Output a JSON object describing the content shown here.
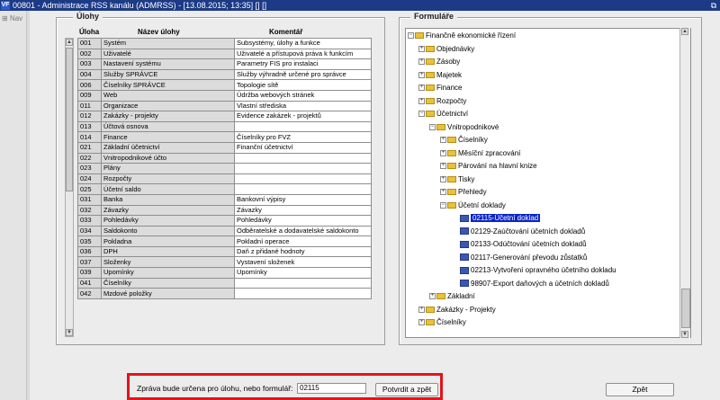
{
  "window": {
    "title": "00801 - Administrace RSS kanálu (ADMRSS) - [13.08.2015; 13:35] [] []",
    "app_icon": "VF",
    "restore_icon": "restore-window-icon"
  },
  "sidenav": {
    "label": "Nav"
  },
  "tasks_panel": {
    "title": "Úlohy",
    "headers": {
      "uloha": "Úloha",
      "nazev": "Název úlohy",
      "komentar": "Komentář"
    },
    "rows": [
      [
        "001",
        "Systém",
        "Subsystémy, úlohy a funkce"
      ],
      [
        "002",
        "Uživatelé",
        "Uživatelé a přístupová práva k funkcím"
      ],
      [
        "003",
        "Nastavení systému",
        "Parametry FIS pro instalaci"
      ],
      [
        "004",
        "Služby SPRÁVCE",
        "Služby výhradně určené pro správce"
      ],
      [
        "006",
        "Číselníky SPRÁVCE",
        "Topologie sítě"
      ],
      [
        "009",
        "Web",
        "Údržba webových stránek"
      ],
      [
        "011",
        "Organizace",
        "Vlastní střediska"
      ],
      [
        "012",
        "Zakázky - projekty",
        "Evidence zakázek - projektů"
      ],
      [
        "013",
        "Účtová osnova",
        ""
      ],
      [
        "014",
        "Finance",
        "Číselníky pro FVZ"
      ],
      [
        "021",
        "Základní účetnictví",
        "Finanční účetnictví"
      ],
      [
        "022",
        "Vnitropodnikové účto",
        ""
      ],
      [
        "023",
        "Plány",
        ""
      ],
      [
        "024",
        "Rozpočty",
        ""
      ],
      [
        "025",
        "Účetní saldo",
        ""
      ],
      [
        "031",
        "Banka",
        "Bankovní výpisy"
      ],
      [
        "032",
        "Závazky",
        "Závazky"
      ],
      [
        "033",
        "Pohledávky",
        "Pohledávky"
      ],
      [
        "034",
        "Saldokonto",
        "Odběratelské a dodavatelské saldokonto"
      ],
      [
        "035",
        "Pokladna",
        "Pokladní operace"
      ],
      [
        "036",
        "DPH",
        "Daň z přidané hodnoty"
      ],
      [
        "037",
        "Složenky",
        "Vystavení složenek"
      ],
      [
        "039",
        "Upomínky",
        "Upomínky"
      ],
      [
        "041",
        "Číselníky",
        ""
      ],
      [
        "042",
        "Mzdové položky",
        ""
      ]
    ]
  },
  "forms_panel": {
    "title": "Formuláře",
    "tree": [
      {
        "level": 0,
        "label": "Finančně ekonomické řízení",
        "icon": "folder-open-icon",
        "expander": "−"
      },
      {
        "level": 1,
        "label": "Objednávky",
        "icon": "folder-icon",
        "expander": "+"
      },
      {
        "level": 1,
        "label": "Zásoby",
        "icon": "folder-icon",
        "expander": "+"
      },
      {
        "level": 1,
        "label": "Majetek",
        "icon": "folder-icon",
        "expander": "+"
      },
      {
        "level": 1,
        "label": "Finance",
        "icon": "folder-icon",
        "expander": "+"
      },
      {
        "level": 1,
        "label": "Rozpočty",
        "icon": "folder-icon",
        "expander": "+"
      },
      {
        "level": 1,
        "label": "Účetnictví",
        "icon": "folder-open-icon",
        "expander": "−"
      },
      {
        "level": 2,
        "label": "Vnitropodnikové",
        "icon": "folder-open-icon",
        "expander": "−"
      },
      {
        "level": 3,
        "label": "Číselníky",
        "icon": "folder-icon",
        "expander": "+"
      },
      {
        "level": 3,
        "label": "Měsíční zpracování",
        "icon": "folder-icon",
        "expander": "+"
      },
      {
        "level": 3,
        "label": "Párování na hlavní knize",
        "icon": "folder-icon",
        "expander": "+"
      },
      {
        "level": 3,
        "label": "Tisky",
        "icon": "folder-icon",
        "expander": "+"
      },
      {
        "level": 3,
        "label": "Přehledy",
        "icon": "folder-icon",
        "expander": "+"
      },
      {
        "level": 3,
        "label": "Účetní doklady",
        "icon": "folder-open-icon",
        "expander": "−"
      },
      {
        "level": 4,
        "label": "02115-Účetní doklad",
        "icon": "form-icon",
        "selected": true
      },
      {
        "level": 4,
        "label": "02129-Zaúčtování účetních dokladů",
        "icon": "form-icon"
      },
      {
        "level": 4,
        "label": "02133-Odúčtování účetních dokladů",
        "icon": "form-icon"
      },
      {
        "level": 4,
        "label": "02117-Generování převodu zůstatků",
        "icon": "form-icon"
      },
      {
        "level": 4,
        "label": "02213-Vytvoření opravného účetního dokladu",
        "icon": "form-icon"
      },
      {
        "level": 4,
        "label": "98907-Export daňových a účetních dokladů",
        "icon": "form-icon"
      },
      {
        "level": 2,
        "label": "Základní",
        "icon": "folder-icon",
        "expander": "+"
      },
      {
        "level": 1,
        "label": "Zakázky - Projekty",
        "icon": "folder-icon",
        "expander": "+"
      },
      {
        "level": 1,
        "label": "Číselníky",
        "icon": "folder-icon",
        "expander": "+"
      }
    ]
  },
  "footer": {
    "message_label": "Zpráva bude určena pro úlohu, nebo formulář:",
    "message_value": "02115",
    "confirm_button": "Potvrdit a zpět",
    "back_button": "Zpět",
    "highlight_color": "#e3141b"
  }
}
